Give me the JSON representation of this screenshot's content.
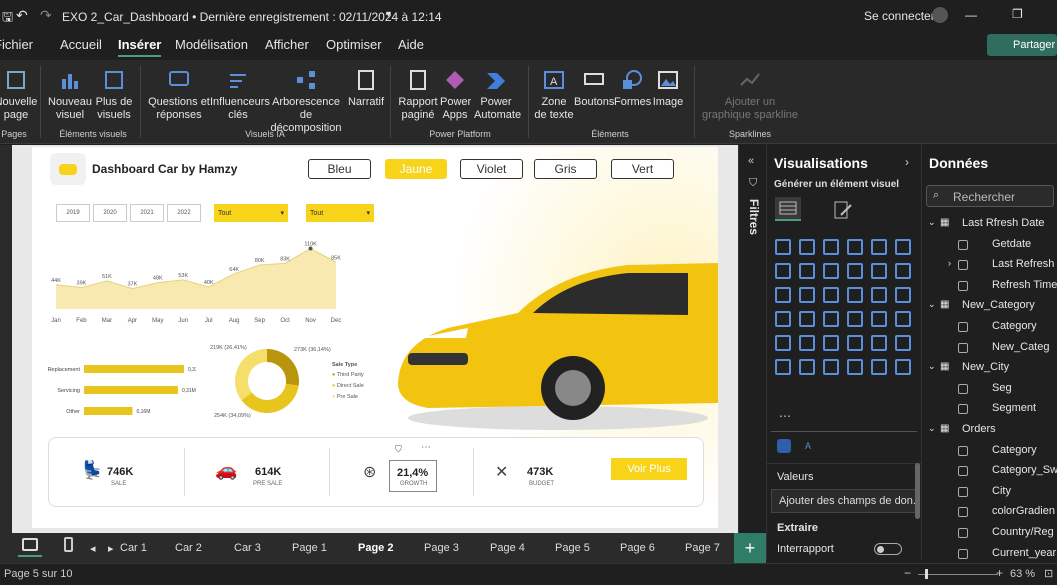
{
  "titlebar": {
    "file_title": "EXO 2_Car_Dashboard • Dernière enregistrement : 02/11/2024 à 12:14",
    "signin": "Se connecter"
  },
  "menu": {
    "items": [
      "Fichier",
      "Accueil",
      "Insérer",
      "Modélisation",
      "Afficher",
      "Optimiser",
      "Aide"
    ],
    "share": "Partager"
  },
  "ribbon": {
    "buttons": [
      "Nouvelle page",
      "Nouveau visuel",
      "Plus de visuels",
      "Questions et réponses",
      "Influenceurs clés",
      "Arborescence de décomposition",
      "Narratif",
      "Rapport paginé",
      "Power Apps",
      "Power Automate",
      "Zone de texte",
      "Boutons",
      "Formes",
      "Image",
      "Ajouter un graphique sparkline"
    ],
    "groups": [
      "Pages",
      "Éléments visuels",
      "Visuels IA",
      "Power Platform",
      "Éléments",
      "Sparklines"
    ]
  },
  "report": {
    "title": "Dashboard Car by Hamzy",
    "color_buttons": [
      "Bleu",
      "Jaune",
      "Violet",
      "Gris",
      "Vert"
    ],
    "years": [
      "2019",
      "2020",
      "2021",
      "2022"
    ],
    "dropdowns": [
      "Tout",
      "Tout"
    ],
    "donut": {
      "title": "Sale Type",
      "legend": [
        "Third Party",
        "Direct Sale",
        "Pre Sale"
      ],
      "labels": [
        "219K (26,41%)",
        "273K (36,14%)",
        "254K (34,09%)"
      ]
    },
    "bars": {
      "labels": [
        "Replacement",
        "Servicing",
        "Other"
      ],
      "values_text": [
        "0,33M",
        "0,31M",
        "0,16M"
      ]
    },
    "kpis": [
      {
        "value": "746K",
        "label": "SALE"
      },
      {
        "value": "614K",
        "label": "PRE SALE"
      },
      {
        "value": "21,4%",
        "label": "GROWTH"
      },
      {
        "value": "473K",
        "label": "BUDGET"
      }
    ],
    "voir_plus": "Voir Plus"
  },
  "chart_data": [
    {
      "type": "area",
      "categories": [
        "Jan",
        "Feb",
        "Mar",
        "Apr",
        "May",
        "Jun",
        "Jul",
        "Aug",
        "Sep",
        "Oct",
        "Nov",
        "Dec"
      ],
      "values": [
        44,
        39,
        51,
        37,
        48,
        53,
        40,
        64,
        80,
        83,
        110,
        85
      ],
      "value_labels": [
        "44K",
        "39K",
        "51K",
        "37K",
        "48K",
        "53K",
        "40K",
        "64K",
        "80K",
        "83K",
        "110K",
        "85K"
      ],
      "ylim": [
        0,
        120
      ],
      "color": "#f7e9b0"
    },
    {
      "type": "pie",
      "labels": [
        "Third Party",
        "Direct Sale",
        "Pre Sale"
      ],
      "values": [
        26.41,
        36.14,
        34.09
      ]
    },
    {
      "type": "bar",
      "categories": [
        "Replacement",
        "Servicing",
        "Other"
      ],
      "values": [
        0.33,
        0.31,
        0.16
      ]
    }
  ],
  "filters_label": "Filtres",
  "viz": {
    "title": "Visualisations",
    "subtitle": "Générer un élément visuel",
    "valeurs": "Valeurs",
    "add_fields": "Ajouter des champs de don...",
    "extraire": "Extraire",
    "interrapport": "Interrapport"
  },
  "data": {
    "title": "Données",
    "search": "Rechercher",
    "items": [
      "Last Rfresh Date",
      "Getdate",
      "Last Refresh",
      "Refresh Time",
      "New_Category",
      "Category",
      "New_Categ",
      "New_City",
      "Seg",
      "Segment",
      "Orders",
      "Category",
      "Category_Sw",
      "City",
      "colorGradien",
      "Country/Reg",
      "Current_year"
    ]
  },
  "tabs": [
    "Car 1",
    "Car 2",
    "Car 3",
    "Page 1",
    "Page 2",
    "Page 3",
    "Page 4",
    "Page 5",
    "Page 6",
    "Page 7"
  ],
  "status": {
    "page": "Page 5 sur 10",
    "zoom": "63 %"
  },
  "colors": {
    "accent": "#f7d31a",
    "teal": "#4c9b8a",
    "dark": "#1f1f1f"
  }
}
